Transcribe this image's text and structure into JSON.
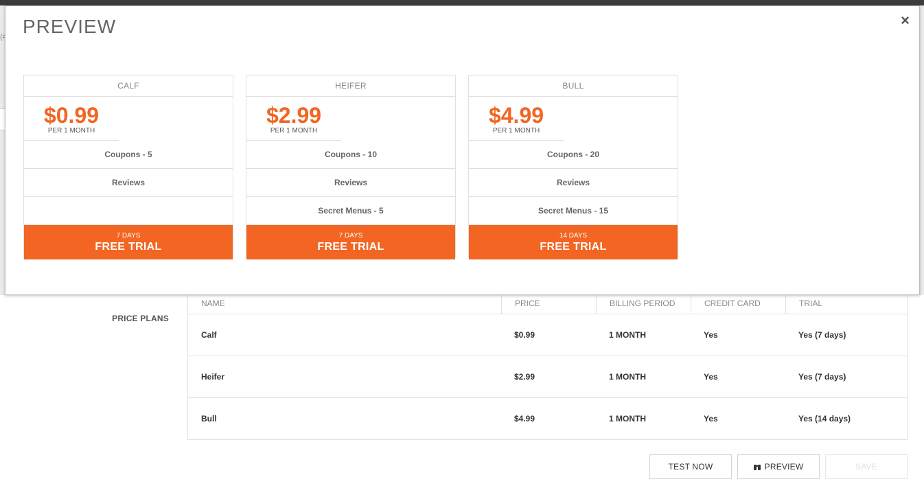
{
  "background": {
    "section_label": "PRICE PLANS",
    "table": {
      "headers": [
        "NAME",
        "PRICE",
        "BILLING PERIOD",
        "CREDIT CARD",
        "TRIAL"
      ],
      "rows": [
        {
          "name": "Calf",
          "price": "$0.99",
          "billing": "1 MONTH",
          "credit_card": "Yes",
          "trial": "Yes (7 days)"
        },
        {
          "name": "Heifer",
          "price": "$2.99",
          "billing": "1 MONTH",
          "credit_card": "Yes",
          "trial": "Yes (7 days)"
        },
        {
          "name": "Bull",
          "price": "$4.99",
          "billing": "1 MONTH",
          "credit_card": "Yes",
          "trial": "Yes (14 days)"
        }
      ]
    },
    "buttons": {
      "test_now": "TEST NOW",
      "preview": "PREVIEW",
      "save": "SAVE"
    },
    "left_edge_fragment": "(##)"
  },
  "modal": {
    "title": "PREVIEW",
    "close": "×",
    "cards": [
      {
        "name": "CALF",
        "price": "$0.99",
        "period": "PER 1 MONTH",
        "features": [
          "Coupons - 5",
          "Reviews",
          ""
        ],
        "trial_days": "7 DAYS",
        "trial_label": "FREE TRIAL"
      },
      {
        "name": "HEIFER",
        "price": "$2.99",
        "period": "PER 1 MONTH",
        "features": [
          "Coupons - 10",
          "Reviews",
          "Secret Menus - 5"
        ],
        "trial_days": "7 DAYS",
        "trial_label": "FREE TRIAL"
      },
      {
        "name": "BULL",
        "price": "$4.99",
        "period": "PER 1 MONTH",
        "features": [
          "Coupons - 20",
          "Reviews",
          "Secret Menus - 15"
        ],
        "trial_days": "14 DAYS",
        "trial_label": "FREE TRIAL"
      }
    ]
  },
  "colors": {
    "accent": "#f26522",
    "overlay_dark": "#3c3c3c",
    "border": "#e0e0e0"
  }
}
